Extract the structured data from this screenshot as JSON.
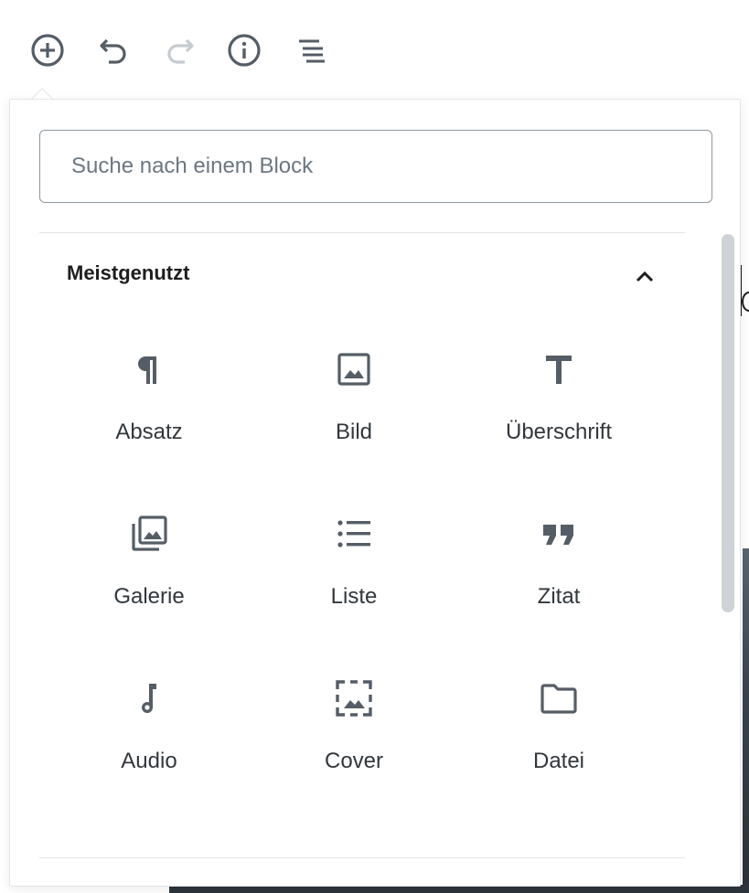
{
  "toolbar": {
    "buttons": [
      {
        "name": "add-block",
        "icon": "plus-circle-icon",
        "enabled": true
      },
      {
        "name": "undo",
        "icon": "undo-icon",
        "enabled": true
      },
      {
        "name": "redo",
        "icon": "redo-icon",
        "enabled": false
      },
      {
        "name": "info",
        "icon": "info-icon",
        "enabled": true
      },
      {
        "name": "outline",
        "icon": "list-outline-icon",
        "enabled": true
      }
    ]
  },
  "inserter": {
    "search": {
      "placeholder": "Suche nach einem Block",
      "value": ""
    },
    "panel": {
      "title": "Meistgenutzt",
      "expanded": true,
      "blocks": [
        {
          "label": "Absatz",
          "icon": "paragraph-icon"
        },
        {
          "label": "Bild",
          "icon": "image-icon"
        },
        {
          "label": "Überschrift",
          "icon": "heading-icon"
        },
        {
          "label": "Galerie",
          "icon": "gallery-icon"
        },
        {
          "label": "Liste",
          "icon": "list-icon"
        },
        {
          "label": "Zitat",
          "icon": "quote-icon"
        },
        {
          "label": "Audio",
          "icon": "audio-icon"
        },
        {
          "label": "Cover",
          "icon": "cover-icon"
        },
        {
          "label": "Datei",
          "icon": "file-icon"
        }
      ]
    }
  },
  "colors": {
    "icon": "#555d66",
    "icon_disabled": "#c5cbd0",
    "text": "#32373c",
    "border": "#e2e4e7"
  }
}
